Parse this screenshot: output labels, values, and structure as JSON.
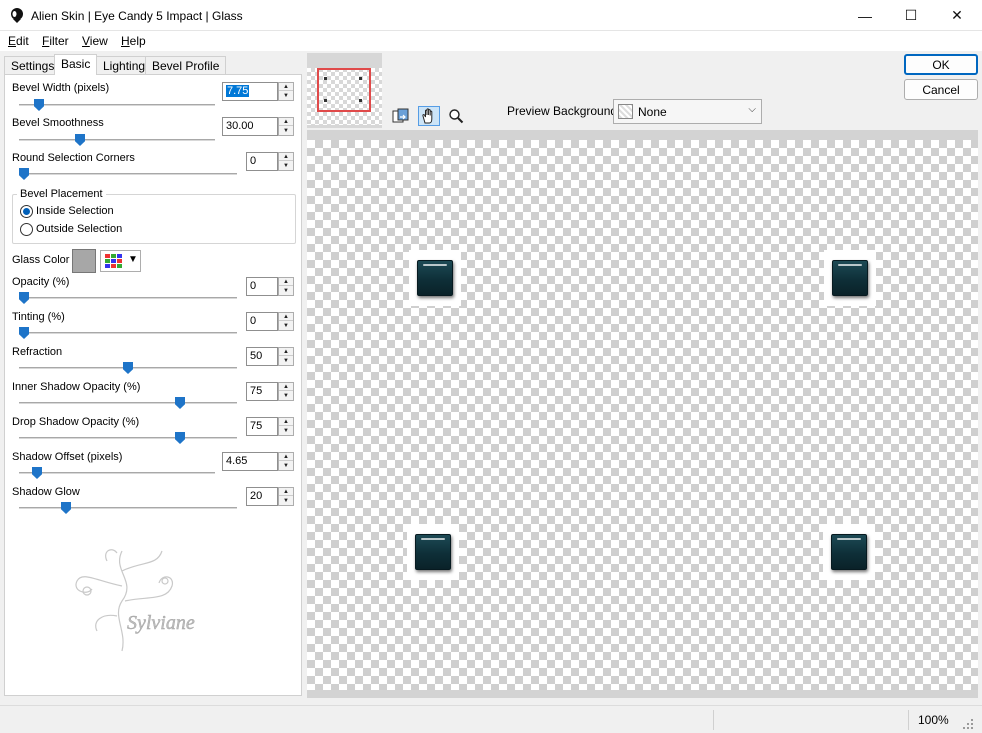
{
  "window": {
    "title": "Alien Skin | Eye Candy 5 Impact | Glass",
    "minimize_glyph": "—",
    "maximize_glyph": "☐",
    "close_glyph": "✕"
  },
  "menu": [
    {
      "ul": "E",
      "rest": "dit"
    },
    {
      "ul": "F",
      "rest": "ilter"
    },
    {
      "ul": "V",
      "rest": "iew"
    },
    {
      "ul": "H",
      "rest": "elp"
    }
  ],
  "tabs": [
    "Settings",
    "Basic",
    "Lighting",
    "Bevel Profile"
  ],
  "active_tab": "Basic",
  "controls": {
    "bevel_width": {
      "label": "Bevel Width (pixels)",
      "value": "7.75",
      "slider_fraction": 0.08
    },
    "bevel_smoothness": {
      "label": "Bevel Smoothness",
      "value": "30.00",
      "slider_fraction": 0.3
    },
    "round_corners": {
      "label": "Round Selection Corners",
      "value": "0",
      "slider_fraction": 0.0
    },
    "bevel_placement": {
      "title": "Bevel Placement",
      "options": [
        "Inside Selection",
        "Outside Selection"
      ],
      "selected": "Inside Selection"
    },
    "glass_color": {
      "label": "Glass Color",
      "swatch": "#a7a7a7"
    },
    "opacity": {
      "label": "Opacity (%)",
      "value": "0",
      "slider_fraction": 0.0
    },
    "tinting": {
      "label": "Tinting (%)",
      "value": "0",
      "slider_fraction": 0.0
    },
    "refraction": {
      "label": "Refraction",
      "value": "50",
      "slider_fraction": 0.5
    },
    "inner_shadow": {
      "label": "Inner Shadow Opacity (%)",
      "value": "75",
      "slider_fraction": 0.75
    },
    "drop_shadow": {
      "label": "Drop Shadow Opacity (%)",
      "value": "75",
      "slider_fraction": 0.75
    },
    "shadow_offset": {
      "label": "Shadow Offset (pixels)",
      "value": "4.65",
      "slider_fraction": 0.07
    },
    "shadow_glow": {
      "label": "Shadow Glow",
      "value": "20",
      "slider_fraction": 0.2
    }
  },
  "watermark_text": "Sylviane",
  "preview": {
    "background_label": "Preview Background:",
    "background_value": "None"
  },
  "buttons": {
    "ok": "OK",
    "cancel": "Cancel"
  },
  "status": {
    "zoom": "100%"
  },
  "colors": {
    "accent": "#0078d7",
    "glass_tile": "#0e2f38",
    "thumb_frame": "#e04a4a"
  }
}
